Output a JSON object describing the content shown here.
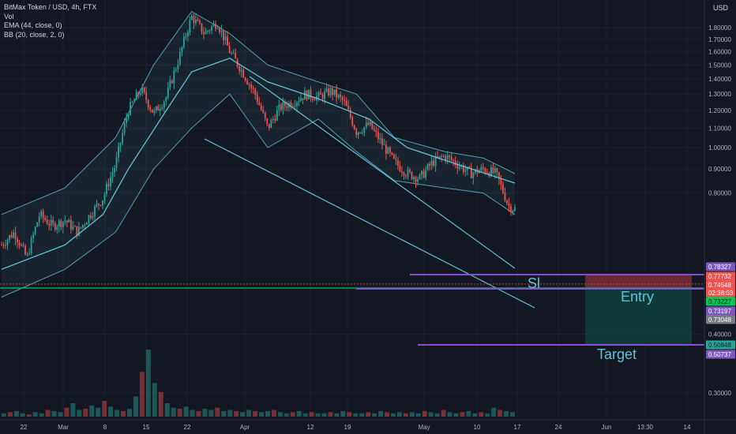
{
  "legend": {
    "symbol": "BitMax Token / USD, 4h, FTX",
    "volume": "Vol",
    "ema": "EMA (44, close, 0)",
    "bb": "BB (20, close, 2, 0)"
  },
  "currency": "USD",
  "chart_data": {
    "type": "candlestick",
    "y_axis": {
      "scale": "log",
      "range": [
        0.27,
        2.0
      ],
      "ticks": [
        "1.80000",
        "1.70000",
        "1.60000",
        "1.50000",
        "1.40000",
        "1.30000",
        "1.20000",
        "1.10000",
        "1.00000",
        "0.90000",
        "0.80000",
        "0.40000",
        "0.30000"
      ]
    },
    "x_axis": {
      "ticks": [
        "22",
        "Mar",
        "8",
        "15",
        "22",
        "Apr",
        "12",
        "19",
        "May",
        "10",
        "17",
        "24",
        "Jun",
        "13:30",
        "14"
      ]
    },
    "price_path": [
      [
        0,
        0.62
      ],
      [
        2,
        0.66
      ],
      [
        4,
        0.58
      ],
      [
        6,
        0.72
      ],
      [
        8,
        0.68
      ],
      [
        10,
        0.7
      ],
      [
        12,
        0.66
      ],
      [
        14,
        0.72
      ],
      [
        16,
        0.78
      ],
      [
        18,
        0.92
      ],
      [
        20,
        1.2
      ],
      [
        22,
        1.33
      ],
      [
        24,
        1.18
      ],
      [
        26,
        1.28
      ],
      [
        28,
        1.55
      ],
      [
        30,
        1.9
      ],
      [
        32,
        1.75
      ],
      [
        34,
        1.85
      ],
      [
        36,
        1.6
      ],
      [
        38,
        1.45
      ],
      [
        40,
        1.3
      ],
      [
        42,
        1.1
      ],
      [
        44,
        1.22
      ],
      [
        46,
        1.25
      ],
      [
        48,
        1.3
      ],
      [
        50,
        1.28
      ],
      [
        52,
        1.32
      ],
      [
        54,
        1.25
      ],
      [
        56,
        1.08
      ],
      [
        58,
        1.12
      ],
      [
        60,
        1.02
      ],
      [
        62,
        0.93
      ],
      [
        64,
        0.88
      ],
      [
        66,
        0.86
      ],
      [
        68,
        0.93
      ],
      [
        70,
        0.96
      ],
      [
        72,
        0.92
      ],
      [
        74,
        0.88
      ],
      [
        76,
        0.9
      ],
      [
        78,
        0.88
      ],
      [
        80,
        0.75
      ],
      [
        81,
        0.74
      ]
    ],
    "ema_path": [
      [
        0,
        0.55
      ],
      [
        10,
        0.62
      ],
      [
        16,
        0.72
      ],
      [
        20,
        0.9
      ],
      [
        26,
        1.2
      ],
      [
        30,
        1.45
      ],
      [
        36,
        1.55
      ],
      [
        42,
        1.38
      ],
      [
        50,
        1.27
      ],
      [
        58,
        1.15
      ],
      [
        64,
        1.0
      ],
      [
        72,
        0.92
      ],
      [
        81,
        0.84
      ]
    ],
    "bb_upper": [
      [
        0,
        0.72
      ],
      [
        10,
        0.82
      ],
      [
        18,
        1.05
      ],
      [
        24,
        1.5
      ],
      [
        30,
        1.95
      ],
      [
        36,
        1.75
      ],
      [
        42,
        1.5
      ],
      [
        50,
        1.38
      ],
      [
        56,
        1.3
      ],
      [
        62,
        1.05
      ],
      [
        70,
        0.98
      ],
      [
        76,
        0.95
      ],
      [
        81,
        0.88
      ]
    ],
    "bb_lower": [
      [
        0,
        0.48
      ],
      [
        10,
        0.55
      ],
      [
        18,
        0.66
      ],
      [
        24,
        0.9
      ],
      [
        30,
        1.1
      ],
      [
        36,
        1.3
      ],
      [
        42,
        1.0
      ],
      [
        50,
        1.15
      ],
      [
        56,
        0.98
      ],
      [
        62,
        0.85
      ],
      [
        70,
        0.82
      ],
      [
        76,
        0.8
      ],
      [
        81,
        0.72
      ]
    ],
    "volume": [
      3,
      4,
      5,
      3,
      2,
      4,
      3,
      6,
      5,
      4,
      8,
      12,
      6,
      7,
      10,
      8,
      14,
      9,
      6,
      5,
      7,
      18,
      40,
      60,
      30,
      22,
      12,
      8,
      7,
      9,
      6,
      5,
      7,
      6,
      8,
      5,
      6,
      5,
      4,
      6,
      5,
      4,
      5,
      6,
      4,
      3,
      4,
      5,
      3,
      4,
      3,
      3,
      4,
      3,
      5,
      4,
      3,
      3,
      4,
      3,
      5,
      4,
      3,
      4,
      3,
      4,
      3,
      5,
      4,
      3,
      6,
      4,
      3,
      4,
      5,
      3,
      4,
      3,
      8,
      6,
      5,
      4
    ],
    "price_tags": [
      {
        "label": "0.78327",
        "color": "#7e57c2"
      },
      {
        "label": "0.77732",
        "color": "#ef5350"
      },
      {
        "label": "0.74548",
        "color": "#ef5350"
      },
      {
        "label": "02:38:03",
        "color": "#ef5350"
      },
      {
        "label": "0.73227",
        "color": "#00c853"
      },
      {
        "label": "0.73197",
        "color": "#7e57c2"
      },
      {
        "label": "0.73048",
        "color": "#787b86"
      },
      {
        "label": "0.50848",
        "color": "#26a69a"
      },
      {
        "label": "0.50737",
        "color": "#7e57c2"
      }
    ],
    "annotations": {
      "sl": "Sl",
      "entry": "Entry",
      "target": "Target"
    },
    "colors": {
      "up": "#26a69a",
      "down": "#ef5350",
      "ema": "#5ec4d9",
      "bb": "#5ec4d9",
      "trendline": "#5ec4d9",
      "horizontal_purple": "#8a4bdb",
      "horizontal_green": "#00c853",
      "risk_zone": "#7a2d36",
      "reward_zone": "#0f3d3a"
    }
  }
}
